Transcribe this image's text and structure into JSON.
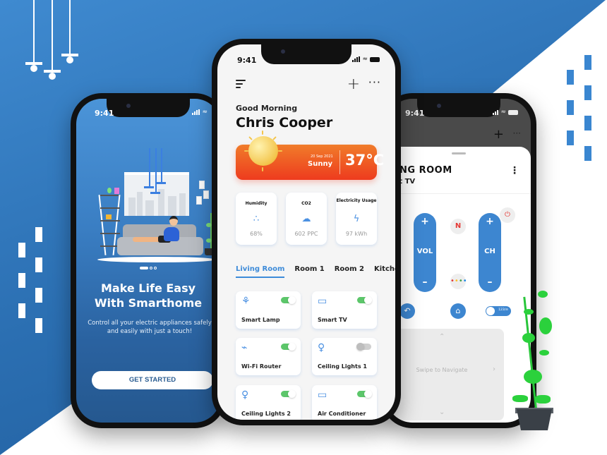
{
  "colors": {
    "brand_blue": "#3d86d0",
    "weather_orange": "#f07c2a",
    "weather_red": "#ee3b1e",
    "toggle_on": "#5cc66a",
    "toggle_off": "#cfcfcf",
    "plant_green": "#2bd13c"
  },
  "onboarding_phone": {
    "status_time": "9:41",
    "page_indicator": {
      "current": 1,
      "total": 3
    },
    "title_line1": "Make Life Easy",
    "title_line2": "With Smarthome",
    "subtitle": "Control all your electric appliances safely and easily with just a touch!",
    "cta_label": "GET STARTED"
  },
  "home_phone": {
    "status_time": "9:41",
    "header": {
      "menu_icon": "menu-icon",
      "add_icon": "+",
      "more_icon": "···"
    },
    "greeting": "Good Morning",
    "user_name": "Chris Cooper",
    "weather": {
      "date": "20 Sep 2021",
      "condition": "Sunny",
      "temperature": "37°C"
    },
    "stats": [
      {
        "label": "Humidity",
        "icon": "droplets-icon",
        "glyph": "∴",
        "value": "68%"
      },
      {
        "label": "CO2",
        "icon": "cloud-co2-icon",
        "glyph": "☁",
        "value": "602 PPC"
      },
      {
        "label": "Electricity Usage",
        "icon": "lightning-icon",
        "glyph": "ϟ",
        "value": "97 kWh"
      }
    ],
    "rooms": [
      {
        "label": "Living Room",
        "active": true
      },
      {
        "label": "Room 1",
        "active": false
      },
      {
        "label": "Room 2",
        "active": false
      },
      {
        "label": "Kitchen",
        "active": false
      }
    ],
    "devices": [
      {
        "name": "Smart Lamp",
        "icon": "lamp-icon",
        "glyph": "⚘",
        "on": true
      },
      {
        "name": "Smart TV",
        "icon": "tv-icon",
        "glyph": "▭",
        "on": true
      },
      {
        "name": "Wi-Fi Router",
        "icon": "router-icon",
        "glyph": "⌁",
        "on": true
      },
      {
        "name": "Ceiling Lights 1",
        "icon": "bulb-icon",
        "glyph": "♀",
        "on": false
      },
      {
        "name": "Ceiling Lights 2",
        "icon": "bulb-icon",
        "glyph": "♀",
        "on": true
      },
      {
        "name": "Air Conditioner",
        "icon": "ac-icon",
        "glyph": "▭",
        "on": true
      }
    ]
  },
  "remote_phone": {
    "status_time": "9:41",
    "room_title": "LIVING ROOM",
    "device_name": "Smart TV",
    "volume": {
      "plus": "+",
      "label": "VOL",
      "minus": "–"
    },
    "channel": {
      "plus": "+",
      "label": "CH",
      "minus": "–"
    },
    "netflix_label": "N",
    "power_glyph": "⏻",
    "back_glyph": "↶",
    "home_glyph": "⌂",
    "mode_toggle_label": "123/≡",
    "swipe_label": "Swipe to Navigate",
    "arrows": {
      "up": "⌃",
      "down": "⌄",
      "left": "‹",
      "right": "›"
    }
  }
}
